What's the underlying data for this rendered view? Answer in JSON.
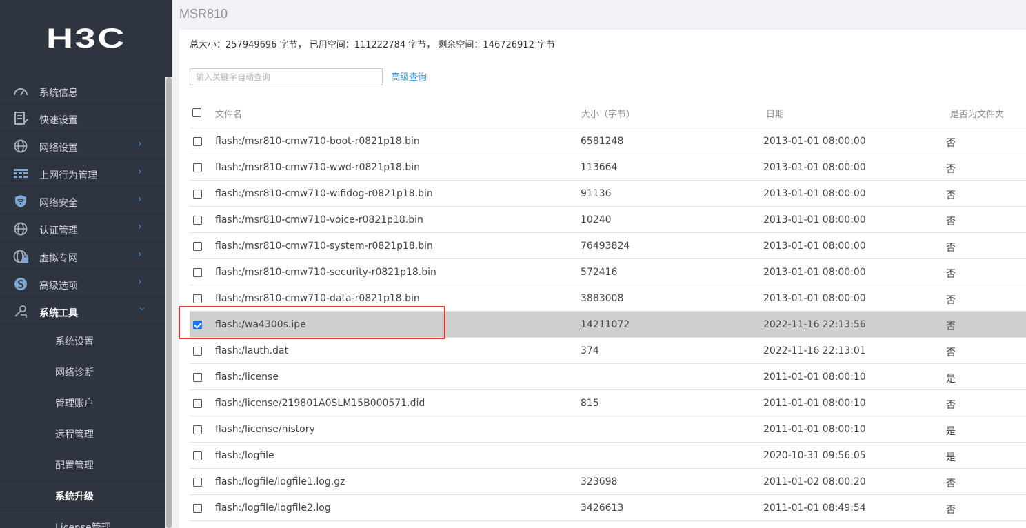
{
  "brand": {
    "logo_text": "H3C"
  },
  "sidebar": {
    "items": [
      {
        "label": "系统信息",
        "icon": "speedometer-icon",
        "has_arrow": false
      },
      {
        "label": "快速设置",
        "icon": "document-edit-icon",
        "has_arrow": false
      },
      {
        "label": "网络设置",
        "icon": "globe-icon",
        "has_arrow": true,
        "arrow": "›"
      },
      {
        "label": "上网行为管理",
        "icon": "table-grid-icon",
        "has_arrow": true,
        "arrow": "›"
      },
      {
        "label": "网络安全",
        "icon": "shield-icon",
        "has_arrow": true,
        "arrow": "›"
      },
      {
        "label": "认证管理",
        "icon": "globe-icon",
        "has_arrow": true,
        "arrow": "›"
      },
      {
        "label": "虚拟专网",
        "icon": "globe-lock-icon",
        "has_arrow": true,
        "arrow": "›"
      },
      {
        "label": "高级选项",
        "icon": "s-circle-icon",
        "has_arrow": true,
        "arrow": "›"
      },
      {
        "label": "系统工具",
        "icon": "tools-icon",
        "has_arrow": true,
        "arrow": "⌄",
        "active": true
      }
    ],
    "sub_items": [
      {
        "label": "系统设置"
      },
      {
        "label": "网络诊断"
      },
      {
        "label": "管理账户"
      },
      {
        "label": "远程管理"
      },
      {
        "label": "配置管理"
      },
      {
        "label": "系统升级",
        "active": true
      },
      {
        "label": "License管理"
      }
    ]
  },
  "main": {
    "title": "MSR810",
    "summary": "总大小：257949696 字节， 已用空间：111222784 字节， 剩余空间：146726912 字节",
    "search": {
      "placeholder": "输入关键字自动查询",
      "value": ""
    },
    "advanced_search_label": "高级查询",
    "table": {
      "columns": [
        "文件名",
        "大小（字节）",
        "日期",
        "是否为文件夹"
      ],
      "rows": [
        {
          "name": "flash:/msr810-cmw710-boot-r0821p18.bin",
          "size": "6581248",
          "date": "2013-01-01 08:00:00",
          "folder": "否",
          "checked": false
        },
        {
          "name": "flash:/msr810-cmw710-wwd-r0821p18.bin",
          "size": "113664",
          "date": "2013-01-01 08:00:00",
          "folder": "否",
          "checked": false
        },
        {
          "name": "flash:/msr810-cmw710-wifidog-r0821p18.bin",
          "size": "91136",
          "date": "2013-01-01 08:00:00",
          "folder": "否",
          "checked": false
        },
        {
          "name": "flash:/msr810-cmw710-voice-r0821p18.bin",
          "size": "10240",
          "date": "2013-01-01 08:00:00",
          "folder": "否",
          "checked": false
        },
        {
          "name": "flash:/msr810-cmw710-system-r0821p18.bin",
          "size": "76493824",
          "date": "2013-01-01 08:00:00",
          "folder": "否",
          "checked": false
        },
        {
          "name": "flash:/msr810-cmw710-security-r0821p18.bin",
          "size": "572416",
          "date": "2013-01-01 08:00:00",
          "folder": "否",
          "checked": false
        },
        {
          "name": "flash:/msr810-cmw710-data-r0821p18.bin",
          "size": "3883008",
          "date": "2013-01-01 08:00:00",
          "folder": "否",
          "checked": false
        },
        {
          "name": "flash:/wa4300s.ipe",
          "size": "14211072",
          "date": "2022-11-16 22:13:56",
          "folder": "否",
          "checked": true,
          "selected": true
        },
        {
          "name": "flash:/lauth.dat",
          "size": "374",
          "date": "2022-11-16 22:13:01",
          "folder": "否",
          "checked": false
        },
        {
          "name": "flash:/license",
          "size": "",
          "date": "2011-01-01 08:00:10",
          "folder": "是",
          "checked": false
        },
        {
          "name": "flash:/license/219801A0SLM15B000571.did",
          "size": "815",
          "date": "2011-01-01 08:00:10",
          "folder": "否",
          "checked": false
        },
        {
          "name": "flash:/license/history",
          "size": "",
          "date": "2011-01-01 08:00:10",
          "folder": "是",
          "checked": false
        },
        {
          "name": "flash:/logfile",
          "size": "",
          "date": "2020-10-31 09:56:05",
          "folder": "是",
          "checked": false
        },
        {
          "name": "flash:/logfile/logfile1.log.gz",
          "size": "323698",
          "date": "2011-01-02 08:00:20",
          "folder": "否",
          "checked": false
        },
        {
          "name": "flash:/logfile/logfile2.log",
          "size": "3426613",
          "date": "2011-01-01 08:49:54",
          "folder": "否",
          "checked": false
        }
      ]
    }
  },
  "colors": {
    "sidebar_bg": "#2f3540",
    "accent": "#4a90e2",
    "link": "#3a9ad9",
    "selected_row": "#cfcfcf",
    "highlight": "#e03131"
  }
}
